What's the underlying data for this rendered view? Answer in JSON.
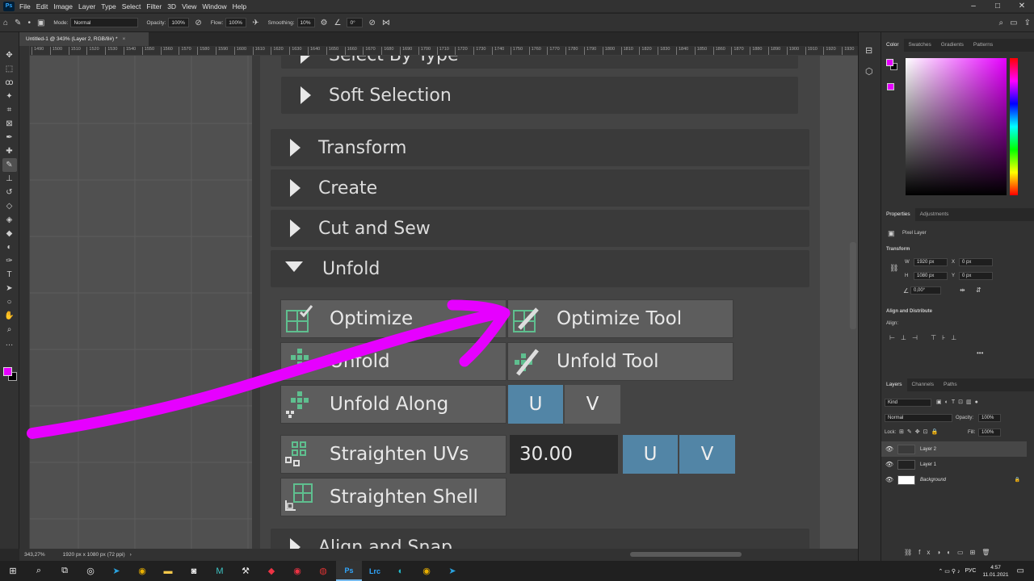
{
  "menu": [
    "File",
    "Edit",
    "Image",
    "Layer",
    "Type",
    "Select",
    "Filter",
    "3D",
    "View",
    "Window",
    "Help"
  ],
  "app_badge": "Ps",
  "options": {
    "mode_label": "Mode:",
    "mode_value": "Normal",
    "opacity_label": "Opacity:",
    "opacity_value": "100%",
    "flow_label": "Flow:",
    "flow_value": "100%",
    "smoothing_label": "Smoothing:",
    "smoothing_value": "10%",
    "angle_value": "0°"
  },
  "document_tab": "Untitled-1 @ 343% (Layer 2, RGB/8#) *",
  "ruler_ticks": [
    "1490",
    "1500",
    "1510",
    "1520",
    "1530",
    "1540",
    "1550",
    "1560",
    "1570",
    "1580",
    "1590",
    "1600",
    "1610",
    "1620",
    "1630",
    "1640",
    "1650",
    "1660",
    "1670",
    "1680",
    "1690",
    "1700",
    "1710",
    "1720",
    "1730",
    "1740",
    "1750",
    "1760",
    "1770",
    "1780",
    "1790",
    "1800",
    "1810",
    "1820",
    "1830",
    "1840",
    "1850",
    "1860",
    "1870",
    "1880",
    "1890",
    "1900",
    "1910",
    "1920",
    "1930"
  ],
  "status": {
    "zoom": "343,27%",
    "docsize": "1920 px x 1080 px (72 ppi)"
  },
  "maya": {
    "select_by_type": "Select By Type",
    "soft_selection": "Soft Selection",
    "transform": "Transform",
    "create": "Create",
    "cut_and_sew": "Cut and Sew",
    "unfold_header": "Unfold",
    "optimize": "Optimize",
    "optimize_tool": "Optimize Tool",
    "unfold": "Unfold",
    "unfold_tool": "Unfold Tool",
    "unfold_along": "Unfold Along",
    "u": "U",
    "v": "V",
    "straighten_uvs": "Straighten UVs",
    "straighten_value": "30.00",
    "straighten_shell": "Straighten Shell",
    "align_and_snap": "Align and Snap"
  },
  "color_panel": {
    "tabs": [
      "Color",
      "Swatches",
      "Gradients",
      "Patterns"
    ]
  },
  "properties_panel": {
    "tabs": [
      "Properties",
      "Adjustments"
    ],
    "pixel_layer": "Pixel Layer",
    "transform": "Transform",
    "w_label": "W",
    "w_value": "1920 px",
    "h_label": "H",
    "h_value": "1080 px",
    "x_label": "X",
    "x_value": "0 px",
    "y_label": "Y",
    "y_value": "0 px",
    "angle_value": "0,00°",
    "align_distribute": "Align and Distribute",
    "align_label": "Align:"
  },
  "layers_panel": {
    "tabs": [
      "Layers",
      "Channels",
      "Paths"
    ],
    "filter": "Kind",
    "blend": "Normal",
    "opacity_label": "Opacity:",
    "opacity_value": "100%",
    "lock_label": "Lock:",
    "fill_label": "Fill:",
    "fill_value": "100%",
    "layers": [
      "Layer 2",
      "Layer 1",
      "Background"
    ]
  },
  "tray": {
    "lang": "РУС",
    "time": "4:57",
    "date": "11.01.2021"
  },
  "colors": {
    "accent_magenta": "#e600ff",
    "maya_blue": "#5285a6"
  }
}
